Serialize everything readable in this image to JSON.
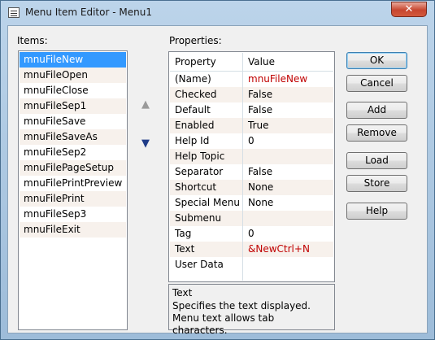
{
  "window": {
    "title": "Menu Item Editor - Menu1"
  },
  "items_label": "Items:",
  "items": [
    "mnuFileNew",
    "mnuFileOpen",
    "mnuFileClose",
    "mnuFileSep1",
    "mnuFileSave",
    "mnuFileSaveAs",
    "mnuFileSep2",
    "mnuFilePageSetup",
    "mnuFilePrintPreview",
    "mnuFilePrint",
    "mnuFileSep3",
    "mnuFileExit"
  ],
  "selected_item": "mnuFileNew",
  "properties_label": "Properties:",
  "grid": {
    "col_property": "Property",
    "col_value": "Value",
    "rows": [
      {
        "name": "(Name)",
        "value": "mnuFileNew",
        "highlight": true
      },
      {
        "name": "Checked",
        "value": "False",
        "highlight": false
      },
      {
        "name": "Default",
        "value": "False",
        "highlight": false
      },
      {
        "name": "Enabled",
        "value": "True",
        "highlight": false
      },
      {
        "name": "Help Id",
        "value": "0",
        "highlight": false
      },
      {
        "name": "Help Topic",
        "value": "",
        "highlight": false
      },
      {
        "name": "Separator",
        "value": "False",
        "highlight": false
      },
      {
        "name": "Shortcut",
        "value": "None",
        "highlight": false
      },
      {
        "name": "Special Menu",
        "value": "None",
        "highlight": false
      },
      {
        "name": "Submenu",
        "value": "",
        "highlight": false
      },
      {
        "name": "Tag",
        "value": "0",
        "highlight": false
      },
      {
        "name": "Text",
        "value": "&NewCtrl+N",
        "highlight": true
      },
      {
        "name": "User Data",
        "value": "",
        "highlight": false
      }
    ]
  },
  "description": {
    "title": "Text",
    "text": "Specifies the text displayed. Menu text allows tab characters."
  },
  "buttons": {
    "ok": "OK",
    "cancel": "Cancel",
    "add": "Add",
    "remove": "Remove",
    "load": "Load",
    "store": "Store",
    "help": "Help"
  },
  "arrows": {
    "up": "▲",
    "down": "▼"
  },
  "icons": {
    "app": "window-icon",
    "close": "close-icon",
    "move_up": "arrow-up-icon",
    "move_down": "arrow-down-icon"
  },
  "colors": {
    "selection": "#3399ff",
    "highlight_value": "#c00000",
    "move_down_arrow": "#1f3c88",
    "move_up_arrow": "#9a9a9a"
  }
}
